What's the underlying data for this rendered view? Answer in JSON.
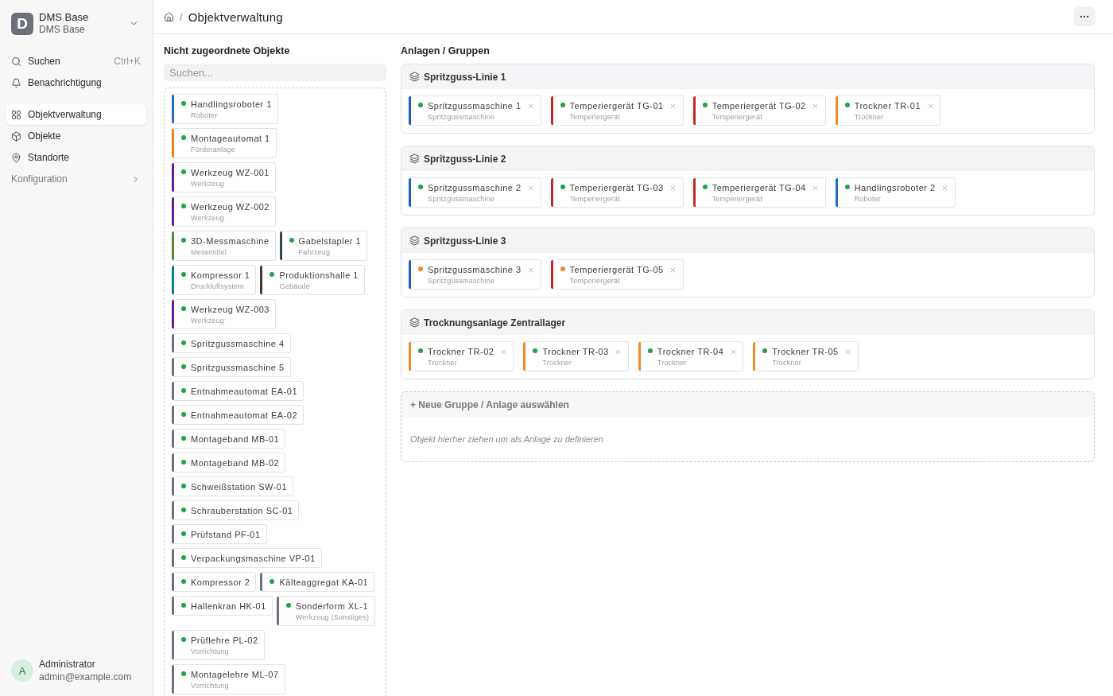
{
  "sidebar": {
    "workspace": {
      "initial": "D",
      "name": "DMS Base",
      "subtitle": "DMS Base"
    },
    "quick_actions": [
      {
        "kind": "search",
        "label": "Suchen",
        "shortcut": "Ctrl+K"
      },
      {
        "kind": "notifications",
        "label": "Benachrichtigung"
      }
    ],
    "nav_items": [
      {
        "kind": "overview",
        "label": "Objektverwaltung",
        "selected": true
      },
      {
        "kind": "objects",
        "label": "Objekte",
        "selected": false
      },
      {
        "kind": "locations",
        "label": "Standorte",
        "selected": false
      }
    ],
    "section": {
      "label": "Konfiguration",
      "expanded": false
    },
    "user": {
      "initial": "A",
      "name": "Administrator",
      "email": "admin@example.com"
    }
  },
  "breadcrumb": {
    "separator": "/",
    "current": "Objektverwaltung"
  },
  "unassigned": {
    "title": "Nicht zugeordnete Objekte",
    "search": {
      "placeholder": "Suchen..."
    },
    "items": [
      {
        "name": "Handlingsroboter 1",
        "type": "Roboter",
        "color": "#1f6fbf",
        "status": {
          "color": "#22a04b"
        }
      },
      {
        "name": "Montageautomat 1",
        "type": "Förderanlage",
        "color": "#ee7d1d",
        "status": {
          "color": "#22a04b"
        }
      },
      {
        "name": "Werkzeug WZ-001",
        "type": "Werkzeug",
        "color": "#6a1b9a",
        "status": {
          "color": "#22a04b"
        }
      },
      {
        "name": "Werkzeug WZ-002",
        "type": "Werkzeug",
        "color": "#6a1b9a",
        "status": {
          "color": "#22a04b"
        }
      },
      {
        "name": "3D-Messmaschine",
        "type": "Messmittel",
        "color": "#558b2f",
        "status": {
          "color": "#22a04b"
        }
      },
      {
        "name": "Gabelstapler 1",
        "type": "Fahrzeug",
        "color": "#37474f",
        "status": {
          "color": "#22a04b"
        }
      },
      {
        "name": "Kompressor 1",
        "type": "Druckluftsystem",
        "color": "#00838f",
        "status": {
          "color": "#22a04b"
        }
      },
      {
        "name": "Produktionshalle 1",
        "type": "Gebäude",
        "color": "#4e342e",
        "status": {
          "color": "#22a04b"
        }
      },
      {
        "name": "Werkzeug WZ-003",
        "type": "Werkzeug",
        "color": "#6a1b9a",
        "status": {
          "color": "#22a04b"
        }
      },
      {
        "name": "Spritzgussmaschine 4",
        "color": "#6b7280",
        "status": {
          "color": "#22a04b"
        }
      },
      {
        "name": "Spritzgussmaschine 5",
        "color": "#6b7280",
        "status": {
          "color": "#22a04b"
        }
      },
      {
        "name": "Entnahmeautomat EA-01",
        "color": "#6b7280",
        "status": {
          "color": "#22a04b"
        }
      },
      {
        "name": "Entnahmeautomat EA-02",
        "color": "#6b7280",
        "status": {
          "color": "#22a04b"
        }
      },
      {
        "name": "Montageband MB-01",
        "color": "#6b7280",
        "status": {
          "color": "#22a04b"
        }
      },
      {
        "name": "Montageband MB-02",
        "color": "#6b7280",
        "status": {
          "color": "#22a04b"
        }
      },
      {
        "name": "Schweißstation SW-01",
        "color": "#6b7280",
        "status": {
          "color": "#22a04b"
        }
      },
      {
        "name": "Schrauberstation SC-01",
        "color": "#6b7280",
        "status": {
          "color": "#22a04b"
        }
      },
      {
        "name": "Prüfstand PF-01",
        "color": "#6b7280",
        "status": {
          "color": "#22a04b"
        }
      },
      {
        "name": "Verpackungsmaschine VP-01",
        "color": "#6b7280",
        "status": {
          "color": "#22a04b"
        }
      },
      {
        "name": "Kompressor 2",
        "color": "#6b7280",
        "status": {
          "color": "#22a04b"
        }
      },
      {
        "name": "Kälteaggregat KA-01",
        "color": "#6b7280",
        "status": {
          "color": "#22a04b"
        }
      },
      {
        "name": "Hallenkran HK-01",
        "color": "#6b7280",
        "status": {
          "color": "#22a04b"
        }
      },
      {
        "name": "Sonderform XL-1",
        "type": "Werkzeug (Sonstiges)",
        "color": "#6b7280",
        "status": {
          "color": "#22a04b"
        }
      },
      {
        "name": "Prüflehre PL-02",
        "type": "Vorrichtung",
        "color": "#6b7280",
        "status": {
          "color": "#22a04b"
        }
      },
      {
        "name": "Montagelehre ML-07",
        "type": "Vorrichtung",
        "color": "#6b7280",
        "status": {
          "color": "#22a04b"
        }
      }
    ]
  },
  "groups_panel": {
    "title": "Anlagen / Gruppen",
    "groups": [
      {
        "name": "Spritzguss-Linie 1",
        "items": [
          {
            "name": "Spritzgussmaschine 1",
            "type": "Spritzgussmaschine",
            "color": "#1b5fc2",
            "status": {
              "color": "#22a04b"
            }
          },
          {
            "name": "Temperiergerät TG-01",
            "type": "Temperiergerät",
            "color": "#c62828",
            "status": {
              "color": "#22a04b"
            }
          },
          {
            "name": "Temperiergerät TG-02",
            "type": "Temperiergerät",
            "color": "#c62828",
            "status": {
              "color": "#22a04b"
            }
          },
          {
            "name": "Trockner TR-01",
            "type": "Trockner",
            "color": "#f28b25",
            "status": {
              "color": "#22a04b"
            }
          }
        ]
      },
      {
        "name": "Spritzguss-Linie 2",
        "items": [
          {
            "name": "Spritzgussmaschine 2",
            "type": "Spritzgussmaschine",
            "color": "#1b5fc2",
            "status": {
              "color": "#22a04b"
            }
          },
          {
            "name": "Temperiergerät TG-03",
            "type": "Temperiergerät",
            "color": "#c62828",
            "status": {
              "color": "#22a04b"
            }
          },
          {
            "name": "Temperiergerät TG-04",
            "type": "Temperiergerät",
            "color": "#c62828",
            "status": {
              "color": "#22a04b"
            }
          },
          {
            "name": "Handlingsroboter 2",
            "type": "Roboter",
            "color": "#1f6fbf",
            "status": {
              "color": "#22a04b"
            }
          }
        ]
      },
      {
        "name": "Spritzguss-Linie 3",
        "items": [
          {
            "name": "Spritzgussmaschine 3",
            "type": "Spritzgussmaschine",
            "color": "#1b5fc2",
            "status": {
              "color": "#f5862a"
            }
          },
          {
            "name": "Temperiergerät TG-05",
            "type": "Temperiergerät",
            "color": "#c62828",
            "status": {
              "color": "#f5862a"
            }
          }
        ]
      },
      {
        "name": "Trocknungsanlage Zentrallager",
        "items": [
          {
            "name": "Trockner TR-02",
            "type": "Trockner",
            "color": "#f28b25",
            "status": {
              "color": "#22a04b"
            }
          },
          {
            "name": "Trockner TR-03",
            "type": "Trockner",
            "color": "#f28b25",
            "status": {
              "color": "#22a04b"
            }
          },
          {
            "name": "Trockner TR-04",
            "type": "Trockner",
            "color": "#f28b25",
            "status": {
              "color": "#22a04b"
            }
          },
          {
            "name": "Trockner TR-05",
            "type": "Trockner",
            "color": "#f28b25",
            "status": {
              "color": "#22a04b"
            }
          }
        ]
      }
    ],
    "new_group": {
      "label": "+ Neue Gruppe / Anlage auswählen",
      "hint": "Objekt hierher ziehen um als Anlage zu definieren"
    }
  }
}
